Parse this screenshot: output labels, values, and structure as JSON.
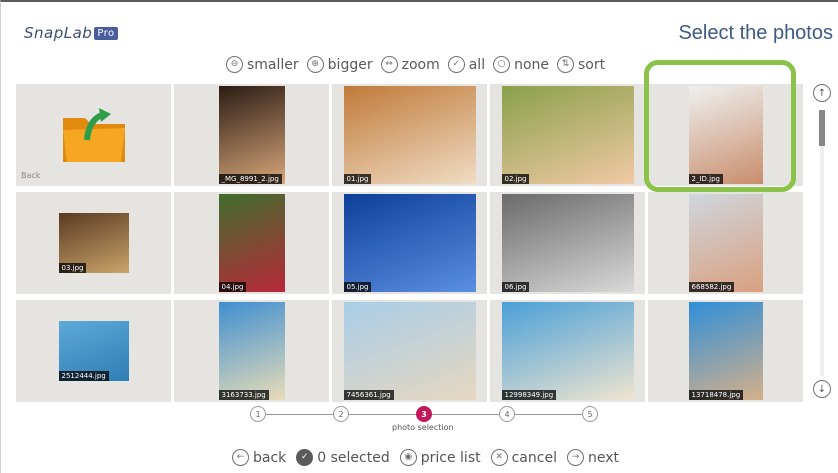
{
  "header": {
    "logo_text": "SnapLab",
    "logo_badge": "Pro",
    "title": "Select the photos"
  },
  "toolbar": [
    {
      "icon": "zoom-out-icon",
      "glyph": "⊖",
      "label": "smaller"
    },
    {
      "icon": "zoom-in-icon",
      "glyph": "⊕",
      "label": "bigger"
    },
    {
      "icon": "zoom-icon",
      "glyph": "⇔",
      "label": "zoom"
    },
    {
      "icon": "select-all-icon",
      "glyph": "✓",
      "label": "all"
    },
    {
      "icon": "select-none-icon",
      "glyph": "○",
      "label": "none"
    },
    {
      "icon": "sort-icon",
      "glyph": "⇅",
      "label": "sort"
    }
  ],
  "photos": [
    {
      "name": "Back",
      "kind": "back",
      "colors": [
        "#f5a623",
        "#e08a10"
      ]
    },
    {
      "name": "_MG_8991_2.jpg",
      "kind": "photo",
      "colors": [
        "#2b1b14",
        "#d8a77a"
      ]
    },
    {
      "name": "01.jpg",
      "kind": "photo",
      "colors": [
        "#c07a3a",
        "#f0dcc4"
      ]
    },
    {
      "name": "02.jpg",
      "kind": "photo",
      "colors": [
        "#8aa04c",
        "#f1c9a4"
      ]
    },
    {
      "name": "2_ID.jpg",
      "kind": "photo",
      "colors": [
        "#eef0f0",
        "#c98d6c"
      ]
    },
    {
      "name": "03.jpg",
      "kind": "photo",
      "colors": [
        "#5a3a22",
        "#c9a46a"
      ]
    },
    {
      "name": "04.jpg",
      "kind": "photo",
      "colors": [
        "#3f6e2d",
        "#b8283a"
      ]
    },
    {
      "name": "05.jpg",
      "kind": "photo",
      "colors": [
        "#0d3f9a",
        "#5b8fe0"
      ]
    },
    {
      "name": "06.jpg",
      "kind": "photo",
      "colors": [
        "#6a6a6a",
        "#d9d9d9"
      ]
    },
    {
      "name": "668582.jpg",
      "kind": "photo",
      "colors": [
        "#cfd6de",
        "#d9a07f"
      ]
    },
    {
      "name": "2512444.jpg",
      "kind": "photo",
      "colors": [
        "#5da9d8",
        "#2e7db5"
      ]
    },
    {
      "name": "3163733.jpg",
      "kind": "photo",
      "colors": [
        "#3f8fd0",
        "#e8dcb8"
      ]
    },
    {
      "name": "7456361.jpg",
      "kind": "photo",
      "colors": [
        "#a9cde8",
        "#e6d7c0"
      ]
    },
    {
      "name": "12998349.jpg",
      "kind": "photo",
      "colors": [
        "#4aa0d8",
        "#efe4cf"
      ]
    },
    {
      "name": "13718478.jpg",
      "kind": "photo",
      "colors": [
        "#2f8fd8",
        "#d6b08a"
      ]
    }
  ],
  "steps": {
    "numbers": [
      "1",
      "2",
      "3",
      "4",
      "5"
    ],
    "active_index": 2,
    "active_label": "photo selection"
  },
  "bottom": [
    {
      "icon": "back-arrow-icon",
      "glyph": "←",
      "label": "back",
      "filled": false
    },
    {
      "icon": "check-icon",
      "glyph": "✓",
      "label": "0 selected",
      "filled": true
    },
    {
      "icon": "price-list-icon",
      "glyph": "◉",
      "label": "price list",
      "filled": false
    },
    {
      "icon": "cancel-icon",
      "glyph": "✕",
      "label": "cancel",
      "filled": false
    },
    {
      "icon": "next-arrow-icon",
      "glyph": "→",
      "label": "next",
      "filled": false
    }
  ],
  "colors": {
    "selection_ring": "#8bc34a",
    "active_step": "#c2185b",
    "title": "#3c5a86"
  }
}
